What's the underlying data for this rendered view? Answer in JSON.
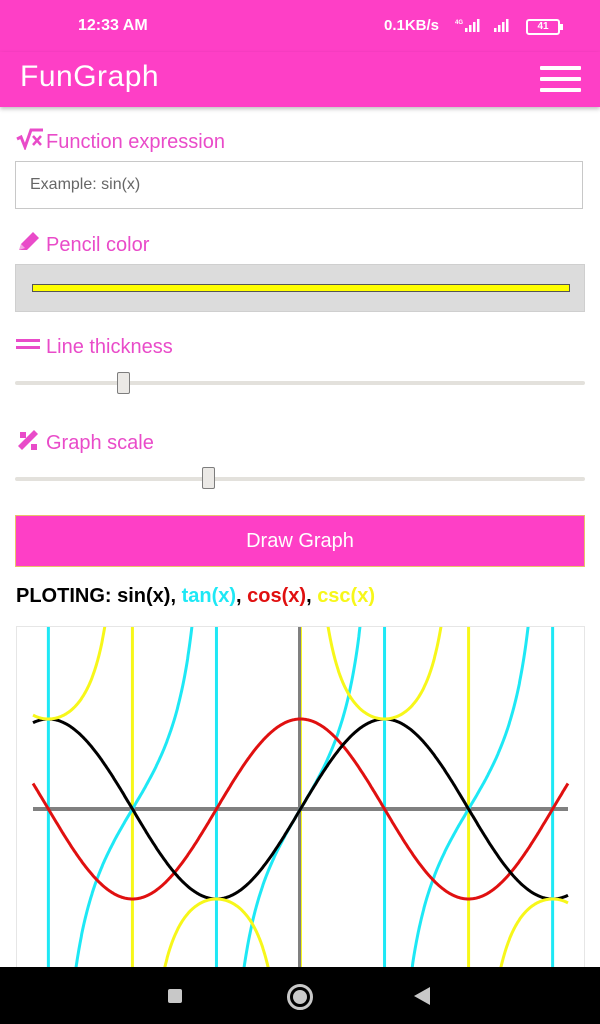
{
  "status_bar": {
    "time": "12:33 AM",
    "network_speed": "0.1KB/s",
    "signal_label": "4G",
    "battery": "41"
  },
  "app_bar": {
    "title": "FunGraph",
    "menu_icon": "hamburger-menu-icon"
  },
  "function_expression": {
    "label": "Function expression",
    "icon": "square-root-x-icon",
    "placeholder": "Example: sin(x)",
    "value": ""
  },
  "pencil_color": {
    "label": "Pencil color",
    "icon": "pencil-icon",
    "value": "#ffff00"
  },
  "line_thickness": {
    "label": "Line thickness",
    "icon": "equals-lines-icon",
    "value_fraction": 0.19
  },
  "graph_scale": {
    "label": "Graph scale",
    "icon": "ruler-pencil-icon",
    "value_fraction": 0.34
  },
  "draw_button": {
    "label": "Draw Graph"
  },
  "plotting": {
    "prefix": "PLOTING: ",
    "functions": [
      {
        "name": "sin(x)",
        "color": "#000000"
      },
      {
        "name": "tan(x)",
        "color": "#1ee8f5"
      },
      {
        "name": "cos(x)",
        "color": "#e01010"
      },
      {
        "name": "csc(x)",
        "color": "#f7f71a"
      }
    ],
    "separator": ", "
  },
  "graph": {
    "x_range": [
      -5.0,
      5.0
    ],
    "y_range": [
      -1.6,
      1.6
    ],
    "axis_color": "#808080"
  },
  "colors": {
    "accent": "#fe3fc6",
    "label": "#e94bc9"
  }
}
